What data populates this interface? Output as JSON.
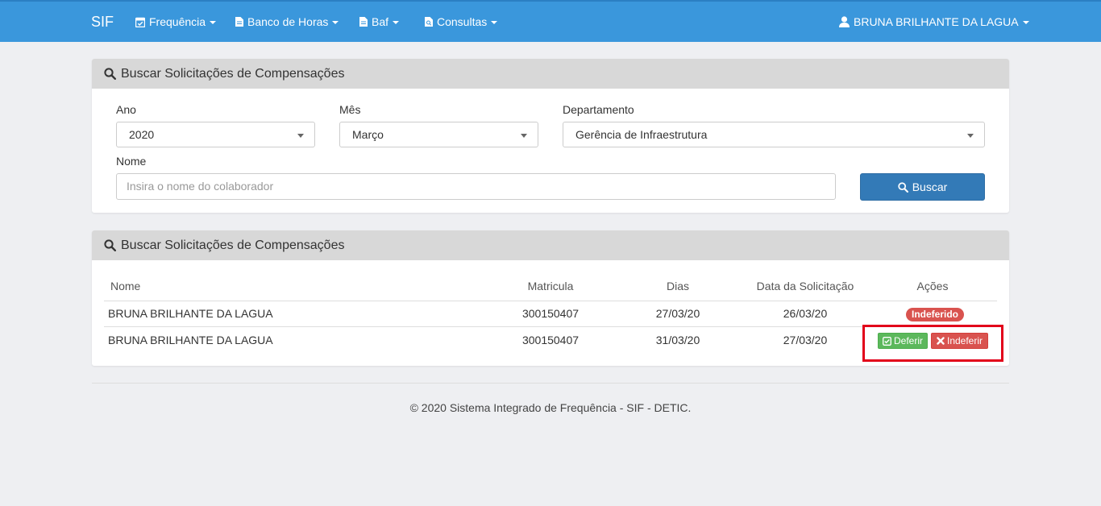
{
  "navbar": {
    "brand": "SIF",
    "items": [
      {
        "label": "Frequência",
        "icon": "calendar-check-icon"
      },
      {
        "label": "Banco de Horas",
        "icon": "file-icon"
      },
      {
        "label": "Baf",
        "icon": "file-icon"
      },
      {
        "label": "Consultas",
        "icon": "file-search-icon"
      }
    ],
    "user": {
      "label": "BRUNA BRILHANTE DA LAGUA",
      "icon": "user-icon"
    }
  },
  "search_panel": {
    "title": "Buscar Solicitações de Compensações",
    "ano": {
      "label": "Ano",
      "value": "2020"
    },
    "mes": {
      "label": "Mês",
      "value": "Março"
    },
    "departamento": {
      "label": "Departamento",
      "value": "Gerência de Infraestrutura"
    },
    "nome": {
      "label": "Nome",
      "placeholder": "Insira o nome do colaborador"
    },
    "search_button": "Buscar"
  },
  "results_panel": {
    "title": "Buscar Solicitações de Compensações",
    "columns": [
      "Nome",
      "Matricula",
      "Dias",
      "Data da Solicitação",
      "Ações"
    ],
    "rows": [
      {
        "nome": "BRUNA BRILHANTE DA LAGUA",
        "matricula": "300150407",
        "dias": "27/03/20",
        "data": "26/03/20",
        "status": "Indeferido"
      },
      {
        "nome": "BRUNA BRILHANTE DA LAGUA",
        "matricula": "300150407",
        "dias": "31/03/20",
        "data": "27/03/20",
        "deferir": "Deferir",
        "indeferir": "Indeferir"
      }
    ]
  },
  "footer": "© 2020 Sistema Integrado de Frequência - SIF - DETIC.",
  "colors": {
    "navbar": "#3a97dc",
    "primary": "#337ab7",
    "success": "#5cb85c",
    "danger": "#d9534f",
    "highlight": "#e2001a"
  }
}
